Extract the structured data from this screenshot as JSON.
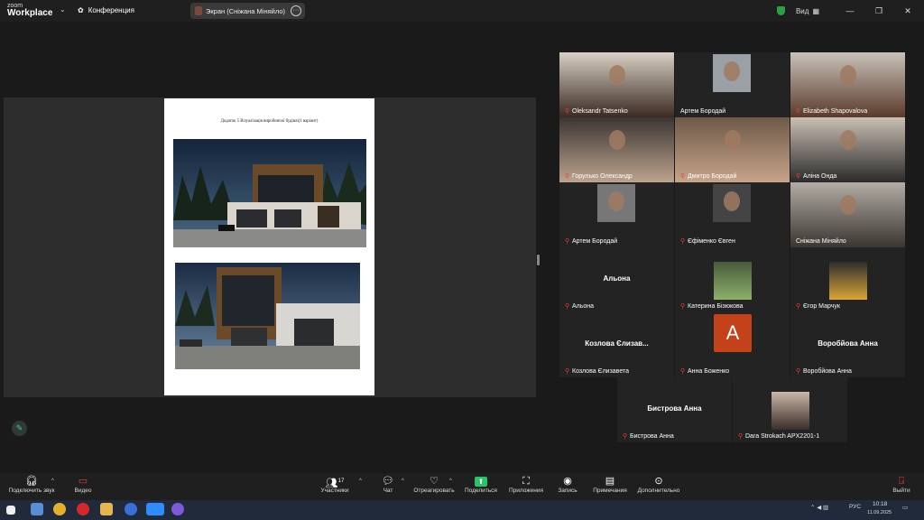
{
  "app": {
    "logo_small": "zoom",
    "logo_big": "Workplace"
  },
  "topbar": {
    "conference_label": "Конференция",
    "screen_share_label": "Экран (Сніжана Міняйло)",
    "view_label": "Вид"
  },
  "document": {
    "caption": "Додаток 5 Візуалізація виробничої будівлі(1 варіант)"
  },
  "participants": [
    {
      "name": "Oleksandr Tatsenko",
      "type": "video",
      "muted": true
    },
    {
      "name": "Артем Бородай",
      "type": "video",
      "muted": false
    },
    {
      "name": "Elizabeth Shapovalova",
      "type": "video",
      "muted": true
    },
    {
      "name": "Горулько Олександр",
      "type": "video",
      "muted": true
    },
    {
      "name": "Дмитро Бородай",
      "type": "video",
      "muted": true
    },
    {
      "name": "Аліна Онда",
      "type": "video",
      "muted": true
    },
    {
      "name": "Артем Бородай",
      "type": "video",
      "muted": true
    },
    {
      "name": "Єфіменко Євген",
      "type": "video",
      "muted": true
    },
    {
      "name": "Сніжана Міняйло",
      "type": "video",
      "muted": false,
      "active_speaker": true
    },
    {
      "name": "Альона",
      "type": "name",
      "display": "Альона",
      "muted": true
    },
    {
      "name": "Катерина Бізюкова",
      "type": "photo",
      "muted": true
    },
    {
      "name": "Єгор Марчук",
      "type": "photo",
      "muted": true
    },
    {
      "name": "Козлова Єлизавета",
      "type": "name",
      "display": "Козлова Єлизав...",
      "muted": true
    },
    {
      "name": "Анна Боженко",
      "type": "avatar",
      "initial": "А",
      "avatar_color": "#c4421a",
      "muted": true
    },
    {
      "name": "Воробйова Анна",
      "type": "name",
      "display": "Воробйова Анна",
      "muted": true
    },
    {
      "name": "Бистрова Анна",
      "type": "name",
      "display": "Бистрова Анна",
      "muted": true
    },
    {
      "name": "Dara Strokach APX2201-1",
      "type": "photo",
      "muted": true
    }
  ],
  "toolbar": {
    "audio": "Подключить звук",
    "video": "Видео",
    "participants": "Участники",
    "participants_count": "17",
    "chat": "Чат",
    "react": "Отреагировать",
    "share": "Поделиться",
    "apps": "Приложения",
    "record": "Запись",
    "notes": "Примечания",
    "more": "Дополнительно",
    "leave": "Выйти"
  },
  "taskbar": {
    "lang": "РУС",
    "time": "10:18",
    "date": "11.09.2025"
  },
  "colors": {
    "active_speaker": "#2fdc87",
    "muted": "#e0453b",
    "share_green": "#27c46b"
  }
}
